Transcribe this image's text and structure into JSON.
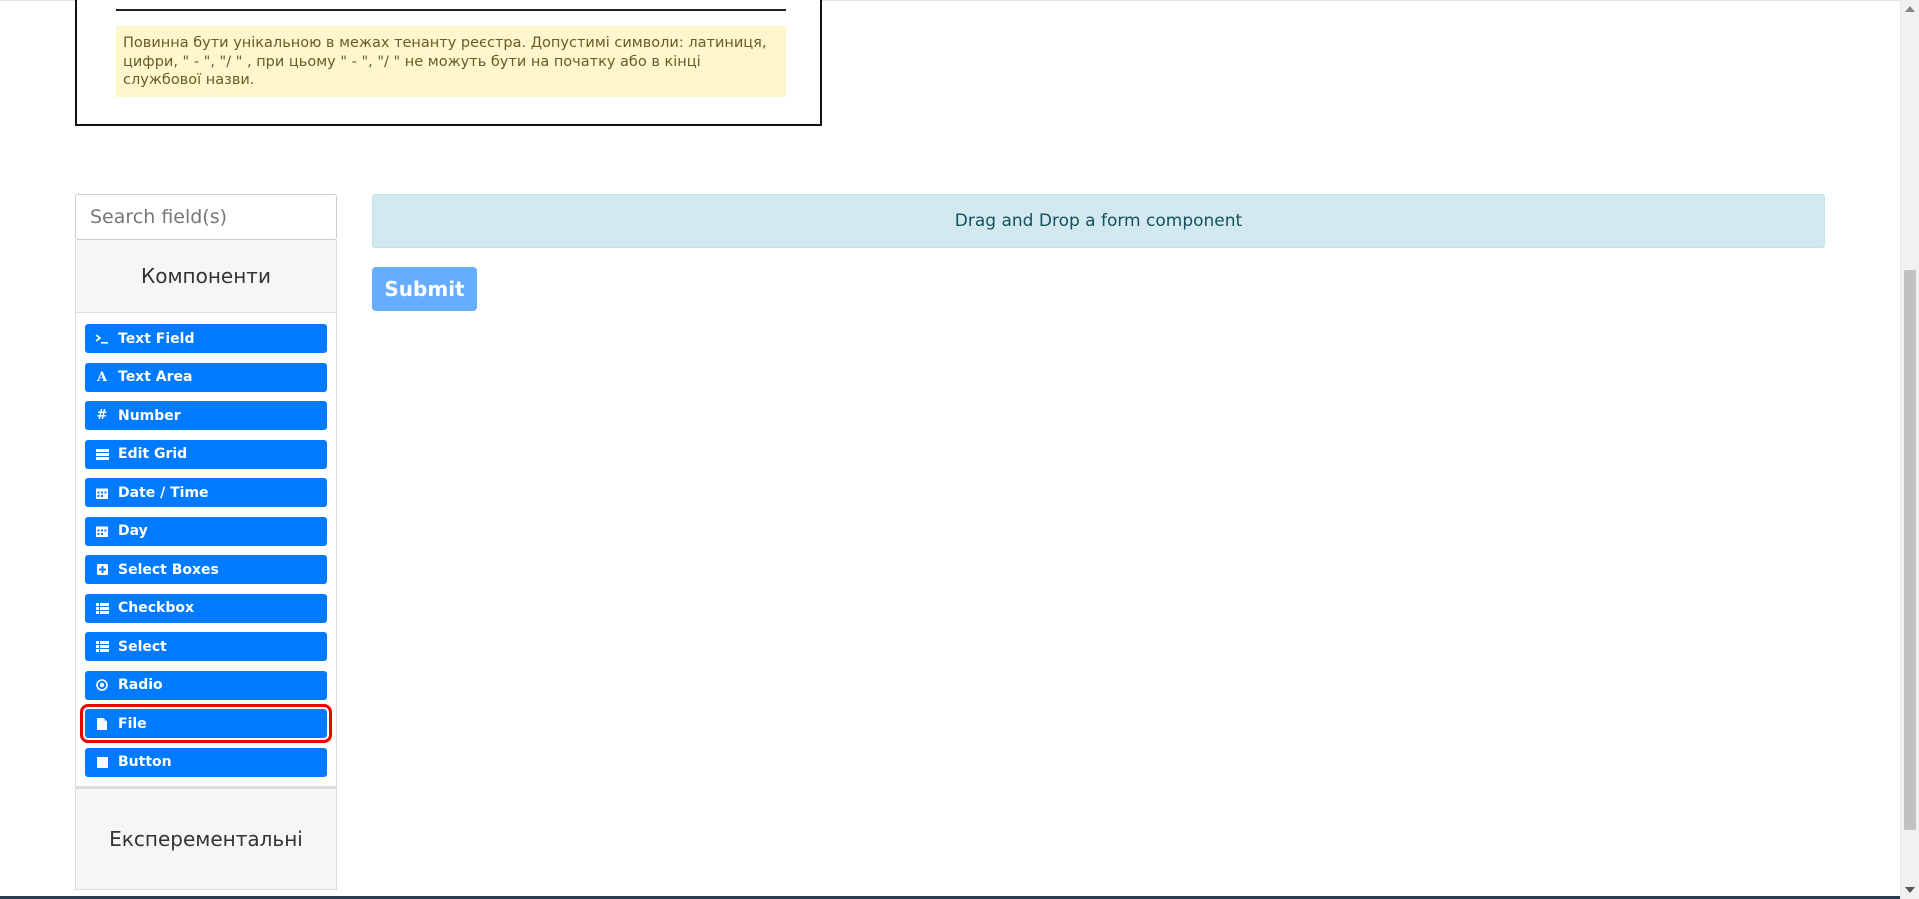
{
  "name_field": {
    "hint": "Повинна бути унікальною в межах тенанту реєстра. Допустимі символи: латиниця, цифри, \" - \", \"/ \" , при цьому  \" - \", \"/ \" не можуть бути на початку або в кінці службової назви."
  },
  "sidebar": {
    "search": {
      "placeholder": "Search field(s)"
    },
    "components_title": "Компоненти",
    "components": [
      {
        "label": "Text Field",
        "icon": "terminal-icon"
      },
      {
        "label": "Text Area",
        "icon": "font-icon"
      },
      {
        "label": "Number",
        "icon": "hash-icon"
      },
      {
        "label": "Edit Grid",
        "icon": "list-icon"
      },
      {
        "label": "Date / Time",
        "icon": "calendar-icon"
      },
      {
        "label": "Day",
        "icon": "calendar-icon"
      },
      {
        "label": "Select Boxes",
        "icon": "plus-square-icon"
      },
      {
        "label": "Checkbox",
        "icon": "list-check-icon"
      },
      {
        "label": "Select",
        "icon": "list-icon"
      },
      {
        "label": "Radio",
        "icon": "dot-circle-icon"
      },
      {
        "label": "File",
        "icon": "file-icon"
      },
      {
        "label": "Button",
        "icon": "stop-icon"
      }
    ],
    "highlighted_component": "File",
    "experimental_title": "Експерементальні"
  },
  "builder": {
    "dropzone_text": "Drag and Drop a form component",
    "submit_label": "Submit"
  },
  "colors": {
    "component_button": "#007bff",
    "dropzone_bg": "#d1e9ef",
    "submit_bg": "#66adff",
    "highlight": "#ee0000",
    "hint_bg": "#fff7cc"
  }
}
